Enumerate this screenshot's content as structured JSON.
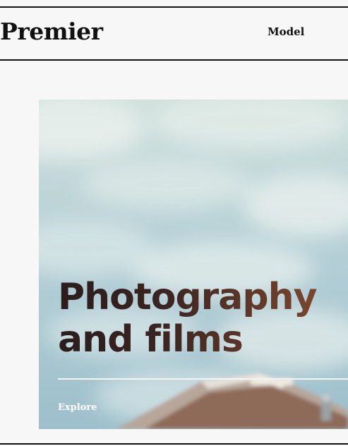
{
  "header": {
    "brand": "Premier",
    "nav": {
      "model_label": "Model"
    }
  },
  "hero": {
    "title_line1": "Photography",
    "title_line2": "and films",
    "cta_label": "Explore"
  },
  "colors": {
    "page_bg": "#f7f7f7",
    "ink": "#111111",
    "sky": "#a9c7d0",
    "title_gradient_start": "#2b1d1c",
    "title_gradient_end": "#7a4630"
  }
}
